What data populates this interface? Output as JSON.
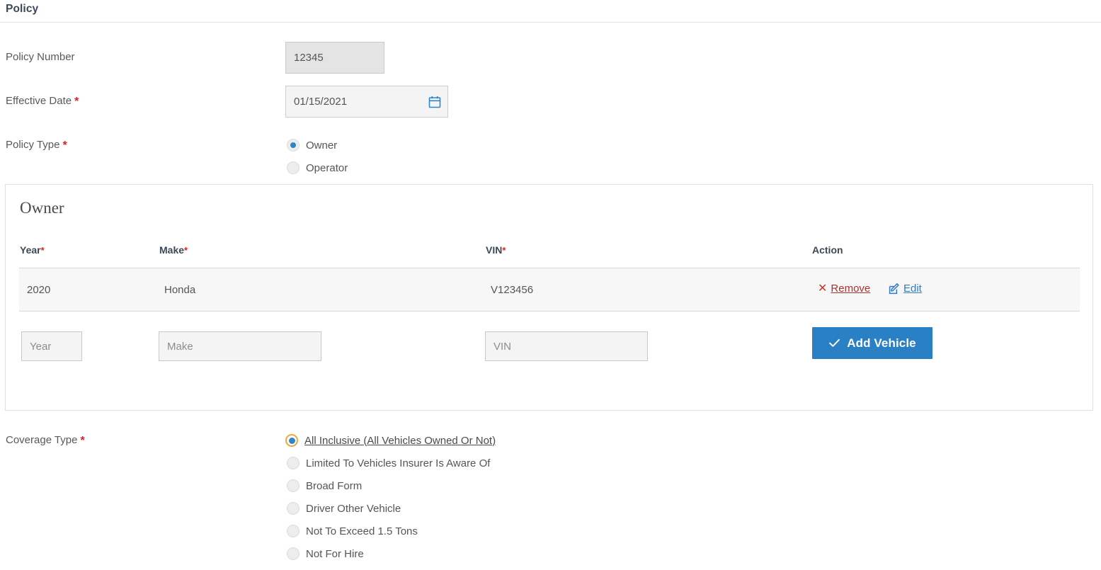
{
  "section": {
    "title": "Policy"
  },
  "fields": {
    "policy_number": {
      "label": "Policy Number",
      "value": "12345",
      "required": false
    },
    "effective_date": {
      "label": "Effective Date",
      "value": "01/15/2021",
      "required": true,
      "icon": "calendar-icon"
    },
    "policy_type": {
      "label": "Policy Type",
      "required": true,
      "options": [
        {
          "label": "Owner",
          "selected": true
        },
        {
          "label": "Operator",
          "selected": false
        }
      ]
    },
    "coverage_type": {
      "label": "Coverage Type",
      "required": true,
      "options": [
        {
          "label": "All Inclusive (All Vehicles Owned Or Not)",
          "selected": true,
          "focused": true
        },
        {
          "label": "Limited To Vehicles Insurer Is Aware Of",
          "selected": false,
          "focused": false
        },
        {
          "label": "Broad Form",
          "selected": false,
          "focused": false
        },
        {
          "label": "Driver Other Vehicle",
          "selected": false,
          "focused": false
        },
        {
          "label": "Not To Exceed 1.5 Tons",
          "selected": false,
          "focused": false
        },
        {
          "label": "Not For Hire",
          "selected": false,
          "focused": false
        }
      ]
    }
  },
  "vehicle_panel": {
    "title": "Owner",
    "columns": [
      {
        "label": "Year",
        "required": true
      },
      {
        "label": "Make",
        "required": true
      },
      {
        "label": "VIN",
        "required": true
      },
      {
        "label": "Action",
        "required": false
      }
    ],
    "rows": [
      {
        "year": "2020",
        "make": "Honda",
        "vin": "V123456",
        "actions": {
          "remove": "Remove",
          "edit": "Edit"
        }
      }
    ],
    "new_row": {
      "year_placeholder": "Year",
      "year_value": "",
      "make_placeholder": "Make",
      "make_value": "",
      "vin_placeholder": "VIN",
      "vin_value": "",
      "add_button": "Add Vehicle"
    }
  },
  "colors": {
    "primary_blue": "#2a80c4",
    "link_blue": "#2f7cc0",
    "remove_red": "#a5362f",
    "required_red": "#e02020",
    "focus_orange": "#f0a63c",
    "heading_navy": "#3c4858"
  }
}
